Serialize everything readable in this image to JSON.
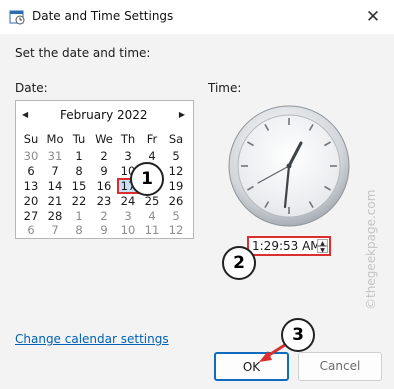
{
  "window": {
    "title": "Date and Time Settings",
    "close_glyph": "✕",
    "icon": "date-time-settings-icon"
  },
  "heading": "Set the date and time:",
  "date": {
    "label": "Date:",
    "prev_glyph": "◀",
    "next_glyph": "▶",
    "month_year": "February 2022",
    "weekdays": [
      "Su",
      "Mo",
      "Tu",
      "We",
      "Th",
      "Fr",
      "Sa"
    ],
    "weeks": [
      [
        "30",
        "31",
        "1",
        "2",
        "3",
        "4",
        "5"
      ],
      [
        "6",
        "7",
        "8",
        "9",
        "10",
        "11",
        "12"
      ],
      [
        "13",
        "14",
        "15",
        "16",
        "17",
        "18",
        "19"
      ],
      [
        "20",
        "21",
        "22",
        "23",
        "24",
        "25",
        "26"
      ],
      [
        "27",
        "28",
        "1",
        "2",
        "3",
        "4",
        "5"
      ],
      [
        "6",
        "7",
        "8",
        "9",
        "10",
        "11",
        "12"
      ]
    ],
    "selected_day": "17"
  },
  "time": {
    "label": "Time:",
    "value": "1:29:53 AM",
    "spin_up_glyph": "▲",
    "spin_down_glyph": "▼"
  },
  "links": {
    "calendar_settings": "Change calendar settings"
  },
  "buttons": {
    "ok": "OK",
    "cancel": "Cancel"
  },
  "annotations": {
    "callout_1": "1",
    "callout_2": "2",
    "callout_3": "3",
    "accent_color": "#d9302f"
  },
  "watermark": "©thegeekpage.com"
}
